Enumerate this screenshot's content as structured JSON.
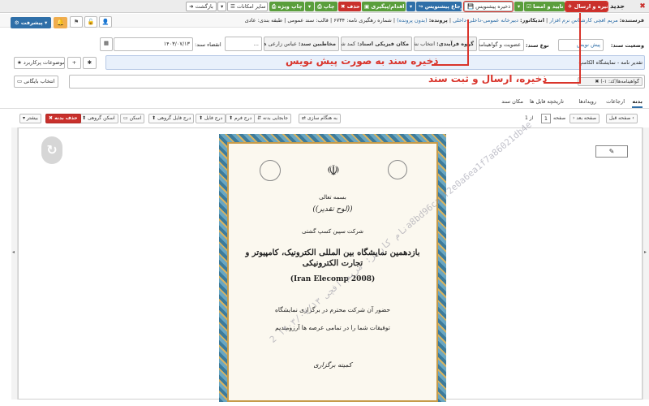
{
  "topbar": {
    "title": "جدید",
    "save_send": "ذخیره و ارسال",
    "approve_sign": "تایید و امضا",
    "save_draft": "ذخیره پیشنویس",
    "refer_draft": "ارجاع پیشنویس",
    "followup": "اقدام/پیگیری",
    "delete": "حذف",
    "print": "چاپ",
    "print_special": "چاپ ویژه",
    "other_options": "سایر امکانات",
    "back": "بازگشت"
  },
  "info": {
    "sender_label": "فرستنده:",
    "sender_value": "مریم افچی کارشناس نرم افزار",
    "indicator_label": "اندیکاتور:",
    "indicator_value": "دبیرخانه عمومی-داخلی-داخلی",
    "file_label": "پرونده:",
    "file_value": "(بدون پرونده)",
    "tracking": "شماره رهگیری نامه: ۶۷۳۴",
    "template": "قالب: سند عمومی",
    "class": "طبقه بندی: عادی",
    "progress_btn": "پیشرفت"
  },
  "form": {
    "status_label": "وضعیت سند:",
    "status_value": "پیش نویس",
    "type_label": "نوع سند:",
    "type_value": "عضویت و گواهینامه",
    "process_group_label": "گروه فرآیندی:",
    "process_group_value": "انتخاب نشده",
    "physical_label": "مکان فیزیکی اسناد:",
    "physical_value": "کمد شماره۲",
    "audience_label": "مخاطبین سند:",
    "audience_value": "عباس زارعی هنرک...",
    "sign_label": "انقضاء سند:",
    "date_value": "۱۴۰۳/۰۷/۱۳",
    "subject_label": "تقدیر نامه - نمایشگاه الکامپ",
    "related_topics": "موضوعات پرکاربرد",
    "certificate_tag": "گواهینامه‌ها(کد: ۱-)",
    "archive_select": "انتخاب بایگانی"
  },
  "annotations": {
    "draft": "ذخیره سند به صورت پیش نویس",
    "send": "ذخیره، ارسال و ثبت سند"
  },
  "tabs": [
    "بدنه",
    "ارجاعات",
    "رویدادها",
    "تاریخچه فایل ها",
    "مکان سند"
  ],
  "doc_toolbar": {
    "prev_page": "صفحه قبل",
    "next_page": "صفحه بعد",
    "page_label": "صفحه",
    "page_num": "1",
    "of_total": "از 1",
    "sync": "به هنگام سازی",
    "replace": "جابجایی بدنه",
    "insert_form": "درج فرم",
    "insert_file": "درج فایل",
    "insert_group_file": "درج فایل گروهی",
    "scan": "اسکن",
    "group_scan": "اسکن گروهی",
    "delete_body": "حذف بدنه",
    "more": "بیشتر"
  },
  "certificate": {
    "bismillah": "بسمه تعالی",
    "title": "((لوح تقدیر))",
    "company": "شرکت سپین کسپ گشتی",
    "event_line": "بازدهمین نمایشگاه بین المللی الکترونیک، کامپیوتر و تجارت الکترونیکی",
    "event_en": "(Iran Elecomp 2008)",
    "body1": "حضور آن شرکت محترم در برگزاری نمایشگاه",
    "body2": "توفیقات شما را در تمامی عرصه ها آرزومندیم",
    "signature": "کمیته برگزاری"
  },
  "watermark": "نام کاربر: مریم افچی ۱۴۰۳/۰۷/۱۳ 2a8bd96ca9f2e0a6ea1f7a86021db4e"
}
